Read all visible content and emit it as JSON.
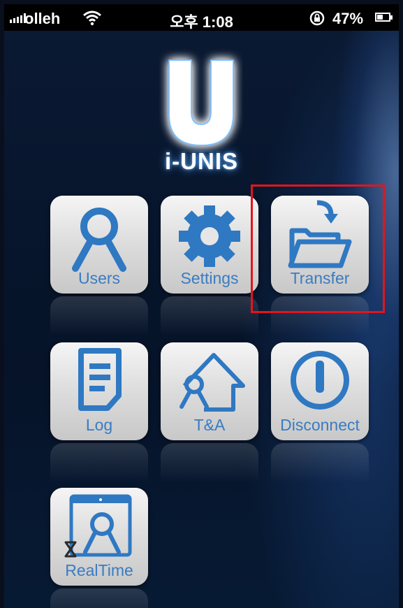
{
  "status_bar": {
    "carrier": "olleh",
    "time": "오후 1:08",
    "battery": "47%",
    "battery_level": 0.47
  },
  "logo": {
    "letter": "U",
    "name": "i-UNIS"
  },
  "apps": [
    {
      "label": "Users",
      "icon": "users-icon"
    },
    {
      "label": "Settings",
      "icon": "gear-icon"
    },
    {
      "label": "Transfer",
      "icon": "folder-transfer-icon"
    },
    {
      "label": "Log",
      "icon": "log-document-icon"
    },
    {
      "label": "T&A",
      "icon": "time-attendance-icon"
    },
    {
      "label": "Disconnect",
      "icon": "power-icon"
    },
    {
      "label": "RealTime",
      "icon": "realtime-monitor-icon"
    }
  ],
  "highlight": {
    "target": "Transfer",
    "color": "#e4141c"
  },
  "colors": {
    "icon_blue": "#2f78c2",
    "label_blue": "#3a7cc2"
  }
}
